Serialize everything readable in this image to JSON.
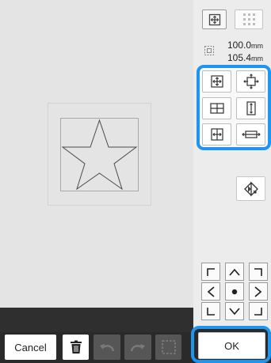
{
  "design": {
    "width": {
      "value": "100.0",
      "unit": "mm"
    },
    "height": {
      "value": "105.4",
      "unit": "mm"
    }
  },
  "panel": {
    "view_icons": [
      "design-view-icon",
      "stitch-grid-icon"
    ],
    "size_icon": "size-icon",
    "resize_icons": [
      "scale-proportional-icon",
      "scale-expand-icon",
      "scale-horizontal-icon",
      "scale-vertical-icon",
      "shrink-horizontal-icon",
      "stretch-horizontal-icon"
    ],
    "mirror_icon": "mirror-icon"
  },
  "move_pad": {
    "icons": [
      "corner-up-left-icon",
      "arrow-up-icon",
      "corner-up-right-icon",
      "arrow-left-icon",
      "center-dot-icon",
      "arrow-right-icon",
      "corner-down-left-icon",
      "arrow-down-icon",
      "corner-down-right-icon"
    ]
  },
  "toolbar": {
    "cancel_label": "Cancel",
    "ok_label": "OK",
    "icons": [
      "trash-icon",
      "undo-icon",
      "redo-icon",
      "select-area-icon"
    ]
  },
  "colors": {
    "accent": "#1e96f0",
    "canvas": "#e4e4e4",
    "panel": "#ececec",
    "bar": "#2a2a2a"
  }
}
